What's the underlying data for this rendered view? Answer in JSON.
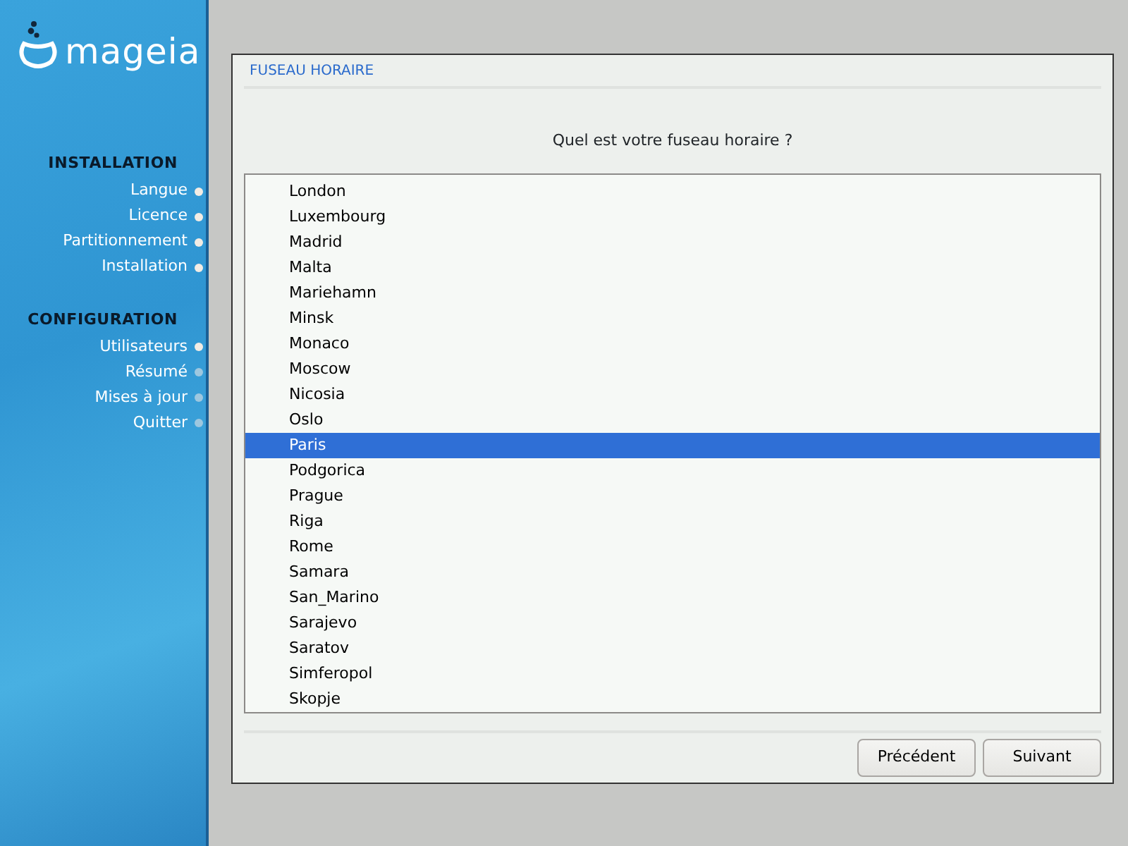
{
  "sidebar": {
    "logo_text": "mageia",
    "sections": [
      {
        "title": "INSTALLATION",
        "steps": [
          {
            "label": "Langue",
            "done": true
          },
          {
            "label": "Licence",
            "done": true
          },
          {
            "label": "Partitionnement",
            "done": true
          },
          {
            "label": "Installation",
            "done": true
          }
        ]
      },
      {
        "title": "CONFIGURATION",
        "steps": [
          {
            "label": "Utilisateurs",
            "done": true
          },
          {
            "label": "Résumé",
            "done": false
          },
          {
            "label": "Mises à jour",
            "done": false
          },
          {
            "label": "Quitter",
            "done": false
          }
        ]
      }
    ]
  },
  "dialog": {
    "title": "FUSEAU HORAIRE",
    "question": "Quel est votre fuseau horaire ?",
    "timezones": [
      {
        "label": "London",
        "selected": false
      },
      {
        "label": "Luxembourg",
        "selected": false
      },
      {
        "label": "Madrid",
        "selected": false
      },
      {
        "label": "Malta",
        "selected": false
      },
      {
        "label": "Mariehamn",
        "selected": false
      },
      {
        "label": "Minsk",
        "selected": false
      },
      {
        "label": "Monaco",
        "selected": false
      },
      {
        "label": "Moscow",
        "selected": false
      },
      {
        "label": "Nicosia",
        "selected": false
      },
      {
        "label": "Oslo",
        "selected": false
      },
      {
        "label": "Paris",
        "selected": true
      },
      {
        "label": "Podgorica",
        "selected": false
      },
      {
        "label": "Prague",
        "selected": false
      },
      {
        "label": "Riga",
        "selected": false
      },
      {
        "label": "Rome",
        "selected": false
      },
      {
        "label": "Samara",
        "selected": false
      },
      {
        "label": "San_Marino",
        "selected": false
      },
      {
        "label": "Sarajevo",
        "selected": false
      },
      {
        "label": "Saratov",
        "selected": false
      },
      {
        "label": "Simferopol",
        "selected": false
      },
      {
        "label": "Skopje",
        "selected": false
      }
    ],
    "buttons": [
      "Précédent",
      "Suivant"
    ]
  }
}
